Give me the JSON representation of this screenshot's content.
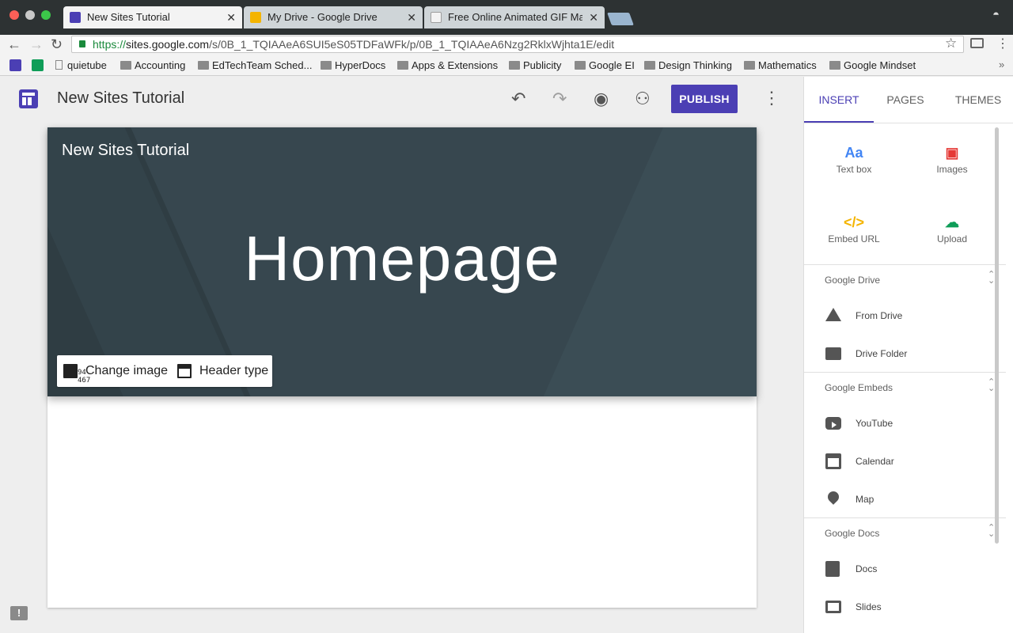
{
  "browser": {
    "tabs": [
      {
        "title": "New Sites Tutorial",
        "close": "✕",
        "favicon_color": "#4b3fb4"
      },
      {
        "title": "My Drive - Google Drive",
        "close": "✕",
        "favicon_color": "#f4b400"
      },
      {
        "title": "Free Online Animated GIF Mak",
        "close": "✕",
        "favicon_color": "#9e9e9e"
      }
    ],
    "url_scheme": "https://",
    "url_host": "sites.google.com",
    "url_path": "/s/0B_1_TQIAAeA6SUI5eS05TDFaWFk/p/0B_1_TQIAAeA6Nzg2RklxWjhta1E/edit",
    "icons": {
      "back": "arrow-left-icon",
      "forward": "arrow-right-icon",
      "reload": "reload-icon",
      "star": "star-icon",
      "cast": "cast-icon",
      "menu": "menu-icon",
      "incognito": "incognito-icon"
    },
    "bookmarks": [
      {
        "label": "quietube",
        "type": "page"
      },
      {
        "label": "Accounting",
        "type": "folder"
      },
      {
        "label": "EdTechTeam Sched...",
        "type": "folder"
      },
      {
        "label": "HyperDocs",
        "type": "folder"
      },
      {
        "label": "Apps & Extensions",
        "type": "folder"
      },
      {
        "label": "Publicity",
        "type": "folder"
      },
      {
        "label": "Google EI",
        "type": "folder"
      },
      {
        "label": "Design Thinking",
        "type": "folder"
      },
      {
        "label": "Mathematics",
        "type": "folder"
      },
      {
        "label": "Google Mindset",
        "type": "folder"
      }
    ],
    "bookmarks_more": "»"
  },
  "editor": {
    "site_title": "New Sites Tutorial",
    "publish_label": "PUBLISH",
    "header_icons": [
      "undo-icon",
      "redo-icon",
      "preview-icon",
      "share-icon",
      "more-icon"
    ],
    "banner": {
      "site_title": "New Sites Tutorial",
      "heading": "Homepage",
      "change_image_label": "Change image",
      "header_type_label": "Header type",
      "cursor_readout": "94\n467"
    },
    "feedback_label": "!"
  },
  "panel": {
    "tabs": [
      "INSERT",
      "PAGES",
      "THEMES"
    ],
    "active_tab": "INSERT",
    "tiles": [
      {
        "label": "Text box",
        "glyph": "Aa",
        "color": "#4285f4",
        "icon": "text-box-icon"
      },
      {
        "label": "Images",
        "glyph": "▣",
        "color": "#e53935",
        "icon": "image-icon"
      },
      {
        "label": "Embed URL",
        "glyph": "</>",
        "color": "#f4b400",
        "icon": "embed-icon"
      },
      {
        "label": "Upload",
        "glyph": "☁",
        "color": "#0f9d58",
        "icon": "upload-icon"
      }
    ],
    "sections": [
      {
        "title": "Google Drive",
        "items": [
          {
            "label": "From Drive",
            "icon": "drive-icon"
          },
          {
            "label": "Drive Folder",
            "icon": "drive-folder-icon"
          }
        ]
      },
      {
        "title": "Google Embeds",
        "items": [
          {
            "label": "YouTube",
            "icon": "youtube-icon"
          },
          {
            "label": "Calendar",
            "icon": "calendar-icon"
          },
          {
            "label": "Map",
            "icon": "map-pin-icon"
          }
        ]
      },
      {
        "title": "Google Docs",
        "items": [
          {
            "label": "Docs",
            "icon": "docs-icon"
          },
          {
            "label": "Slides",
            "icon": "slides-icon"
          }
        ]
      }
    ],
    "collapse_glyph": "⌃\n⌄"
  }
}
